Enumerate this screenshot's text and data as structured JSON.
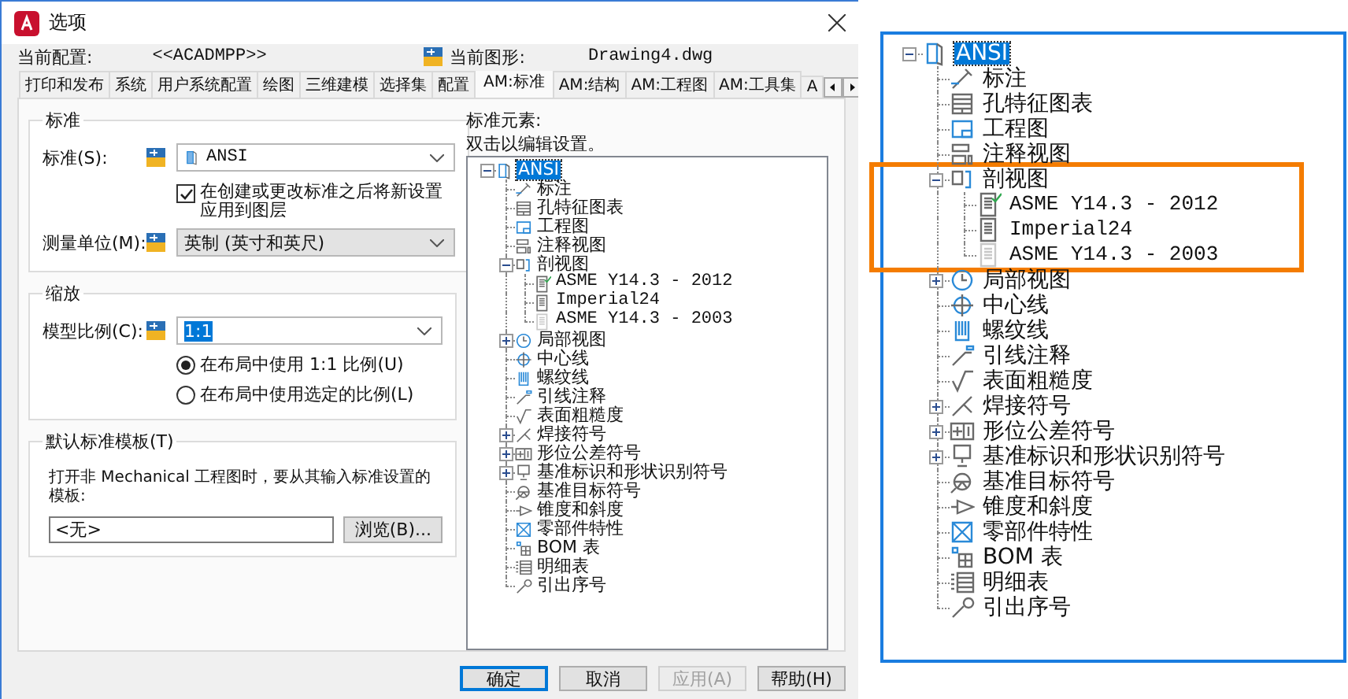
{
  "dialog": {
    "title": "选项",
    "profile_label": "当前配置:",
    "profile_value": "<<ACADMPP>>",
    "drawing_label": "当前图形:",
    "drawing_value": "Drawing4.dwg",
    "tabs": [
      {
        "label": "打印和发布",
        "selected": false
      },
      {
        "label": "系统",
        "selected": false
      },
      {
        "label": "用户系统配置",
        "selected": false
      },
      {
        "label": "绘图",
        "selected": false
      },
      {
        "label": "三维建模",
        "selected": false
      },
      {
        "label": "选择集",
        "selected": false
      },
      {
        "label": "配置",
        "selected": false
      },
      {
        "label": "AM:标准",
        "selected": true
      },
      {
        "label": "AM:结构",
        "selected": false
      },
      {
        "label": "AM:工程图",
        "selected": false
      },
      {
        "label": "AM:工具集",
        "selected": false
      },
      {
        "label": "A",
        "selected": false
      }
    ],
    "standards_group": {
      "title": "标准",
      "standard_label": "标准(S):",
      "standard_value": "ANSI",
      "apply_layers": {
        "label": "在创建或更改标准之后将新设置应用到图层",
        "checked": true
      },
      "units_label": "测量单位(M):",
      "units_value": "英制 (英寸和英尺)"
    },
    "scale_group": {
      "title": "缩放",
      "scale_label": "模型比例(C):",
      "scale_value": "1:1",
      "options": [
        {
          "label": "在布局中使用 1:1 比例(U)",
          "selected": true
        },
        {
          "label": "在布局中使用选定的比例(L)",
          "selected": false
        }
      ]
    },
    "template_group": {
      "title": "默认标准模板(T)",
      "description": "打开非 Mechanical 工程图时，要从其输入标准设置的模板:",
      "value": "<无>",
      "browse_button": "浏览(B)..."
    },
    "elements_label": "标准元素:",
    "elements_hint": "双击以编辑设置。",
    "element_tree": [
      {
        "label": "ANSI",
        "selected": true,
        "expanded": true,
        "children": [
          {
            "label": "标注",
            "selected": false
          },
          {
            "label": "孔特征图表",
            "selected": false
          },
          {
            "label": "工程图",
            "selected": false
          },
          {
            "label": "注释视图",
            "selected": false
          },
          {
            "label": "剖视图",
            "selected": false,
            "expanded": true,
            "children": [
              {
                "label": "ASME Y14.3 - 2012",
                "selected": false,
                "checked": true,
                "disabled": false
              },
              {
                "label": "Imperial24",
                "selected": false,
                "checked": false,
                "disabled": false
              },
              {
                "label": "ASME Y14.3 - 2003",
                "selected": false,
                "checked": false,
                "disabled": true
              }
            ]
          },
          {
            "label": "局部视图",
            "selected": false,
            "expanded": false
          },
          {
            "label": "中心线",
            "selected": false
          },
          {
            "label": "螺纹线",
            "selected": false
          },
          {
            "label": "引线注释",
            "selected": false
          },
          {
            "label": "表面粗糙度",
            "selected": false
          },
          {
            "label": "焊接符号",
            "selected": false,
            "expanded": false
          },
          {
            "label": "形位公差符号",
            "selected": false,
            "expanded": false
          },
          {
            "label": "基准标识和形状识别符号",
            "selected": false,
            "expanded": false
          },
          {
            "label": "基准目标符号",
            "selected": false
          },
          {
            "label": "锥度和斜度",
            "selected": false
          },
          {
            "label": "零部件特性",
            "selected": false
          },
          {
            "label": "BOM 表",
            "selected": false
          },
          {
            "label": "明细表",
            "selected": false
          },
          {
            "label": "引出序号",
            "selected": false
          }
        ]
      }
    ],
    "buttons": [
      {
        "label": "确定",
        "default": true,
        "disabled": false
      },
      {
        "label": "取消",
        "default": false,
        "disabled": false
      },
      {
        "label": "应用(A)",
        "default": false,
        "disabled": true
      },
      {
        "label": "帮助(H)",
        "default": false,
        "disabled": false
      }
    ]
  },
  "zoom_panel": {
    "tree": [
      {
        "label": "ANSI",
        "selected": true,
        "expanded": true,
        "children": [
          {
            "label": "标注",
            "selected": false,
            "highlighted": false
          },
          {
            "label": "孔特征图表",
            "selected": false,
            "highlighted": false
          },
          {
            "label": "工程图",
            "selected": false,
            "highlighted": false
          },
          {
            "label": "注释视图",
            "selected": false,
            "highlighted": false
          },
          {
            "label": "剖视图",
            "selected": false,
            "highlighted": true,
            "expanded": true,
            "children": [
              {
                "label": "ASME Y14.3 - 2012",
                "selected": false,
                "checked": true,
                "disabled": false
              },
              {
                "label": "Imperial24",
                "selected": false,
                "checked": false,
                "disabled": false
              },
              {
                "label": "ASME Y14.3 - 2003",
                "selected": false,
                "checked": false,
                "disabled": true
              }
            ]
          },
          {
            "label": "局部视图",
            "selected": false,
            "highlighted": false,
            "expanded": false
          },
          {
            "label": "中心线",
            "selected": false,
            "highlighted": false
          },
          {
            "label": "螺纹线",
            "selected": false,
            "highlighted": false
          },
          {
            "label": "引线注释",
            "selected": false,
            "highlighted": false
          },
          {
            "label": "表面粗糙度",
            "selected": false,
            "highlighted": false
          },
          {
            "label": "焊接符号",
            "selected": false,
            "highlighted": false,
            "expanded": false
          },
          {
            "label": "形位公差符号",
            "selected": false,
            "highlighted": false,
            "expanded": false
          },
          {
            "label": "基准标识和形状识别符号",
            "selected": false,
            "highlighted": false,
            "expanded": false
          },
          {
            "label": "基准目标符号",
            "selected": false,
            "highlighted": false
          },
          {
            "label": "锥度和斜度",
            "selected": false,
            "highlighted": false
          },
          {
            "label": "零部件特性",
            "selected": false,
            "highlighted": false
          },
          {
            "label": "BOM 表",
            "selected": false,
            "highlighted": false
          },
          {
            "label": "明细表",
            "selected": false,
            "highlighted": false
          },
          {
            "label": "引出序号",
            "selected": false,
            "highlighted": false
          }
        ]
      }
    ]
  }
}
